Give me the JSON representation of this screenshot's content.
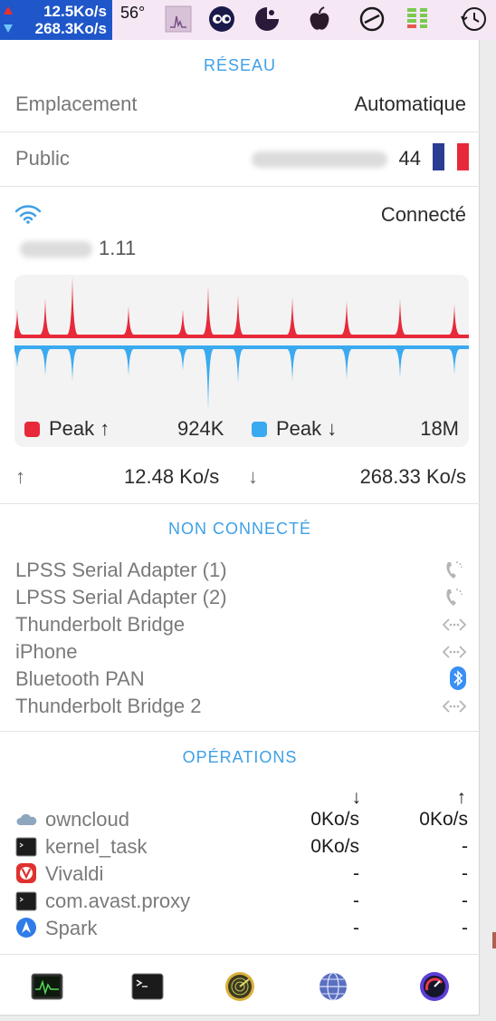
{
  "menubar": {
    "upload_rate": "12.5Ko/s",
    "download_rate": "268.3Ko/s",
    "temperature": "56°",
    "icons": [
      "activity-graph-icon",
      "vpn-eyes-icon",
      "moon-pie-icon",
      "apple-icon",
      "gauge-icon",
      "battery-bars-icon",
      "time-machine-icon"
    ]
  },
  "network": {
    "title": "RÉSEAU",
    "location_label": "Emplacement",
    "location_value": "Automatique",
    "public_label": "Public",
    "public_ip_tail": "44",
    "flag_colors": [
      "#2a3d92",
      "#ffffff",
      "#e8293a"
    ],
    "wifi_status": "Connecté",
    "local_ip_tail": "1.11"
  },
  "graph": {
    "upload_color": "#e8293a",
    "download_color": "#3aaaf0",
    "legend_up_label": "Peak ↑",
    "legend_up_value": "924K",
    "legend_down_label": "Peak ↓",
    "legend_down_value": "18M"
  },
  "rates": {
    "up_arrow": "↑",
    "up_value": "12.48 Ko/s",
    "down_arrow": "↓",
    "down_value": "268.33 Ko/s"
  },
  "not_connected": {
    "title": "NON CONNECTÉ",
    "interfaces": [
      {
        "name": "LPSS Serial Adapter (1)",
        "icon": "phone-icon"
      },
      {
        "name": "LPSS Serial Adapter (2)",
        "icon": "phone-icon"
      },
      {
        "name": "Thunderbolt Bridge",
        "icon": "ethernet-icon"
      },
      {
        "name": "iPhone",
        "icon": "ethernet-icon"
      },
      {
        "name": "Bluetooth PAN",
        "icon": "bluetooth-icon"
      },
      {
        "name": "Thunderbolt Bridge 2",
        "icon": "ethernet-icon"
      }
    ]
  },
  "operations": {
    "title": "OPÉRATIONS",
    "col_down": "↓",
    "col_up": "↑",
    "processes": [
      {
        "name": "owncloud",
        "icon": "cloud-icon",
        "down": "0Ko/s",
        "up": "0Ko/s"
      },
      {
        "name": "kernel_task",
        "icon": "terminal-icon",
        "down": "0Ko/s",
        "up": "-"
      },
      {
        "name": "Vivaldi",
        "icon": "vivaldi-icon",
        "down": "-",
        "up": "-"
      },
      {
        "name": "com.avast.proxy",
        "icon": "terminal-icon",
        "down": "-",
        "up": "-"
      },
      {
        "name": "Spark",
        "icon": "spark-icon",
        "down": "-",
        "up": "-"
      }
    ]
  },
  "toolbar": {
    "buttons": [
      "activity-monitor-icon",
      "terminal-icon",
      "radar-icon",
      "network-globe-icon",
      "speedometer-icon"
    ]
  }
}
